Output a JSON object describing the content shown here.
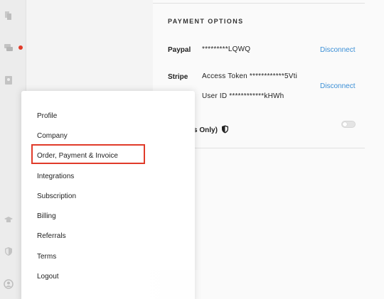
{
  "sidebar": {
    "icons": [
      "documents-icon",
      "chat-icon",
      "contacts-icon",
      "graduation-cap-icon",
      "shield-icon",
      "user-icon"
    ],
    "notification_color": "#e03b2a"
  },
  "payment": {
    "title": "PAYMENT OPTIONS",
    "paypal": {
      "label": "Paypal",
      "value": "*********LQWQ",
      "action": "Disconnect"
    },
    "stripe": {
      "label": "Stripe",
      "access_token": "Access Token ************5Vti",
      "user_id": "User ID ************kHWh",
      "action": "Disconnect"
    },
    "partial_label": "s Only)"
  },
  "menu": {
    "items": [
      {
        "label": "Profile"
      },
      {
        "label": "Company"
      },
      {
        "label": "Order, Payment & Invoice",
        "highlighted": true
      },
      {
        "label": "Integrations"
      },
      {
        "label": "Subscription"
      },
      {
        "label": "Billing"
      },
      {
        "label": "Referrals"
      },
      {
        "label": "Terms"
      },
      {
        "label": "Logout"
      }
    ]
  },
  "colors": {
    "link": "#3b8fd6",
    "highlight_border": "#e03b2a"
  }
}
